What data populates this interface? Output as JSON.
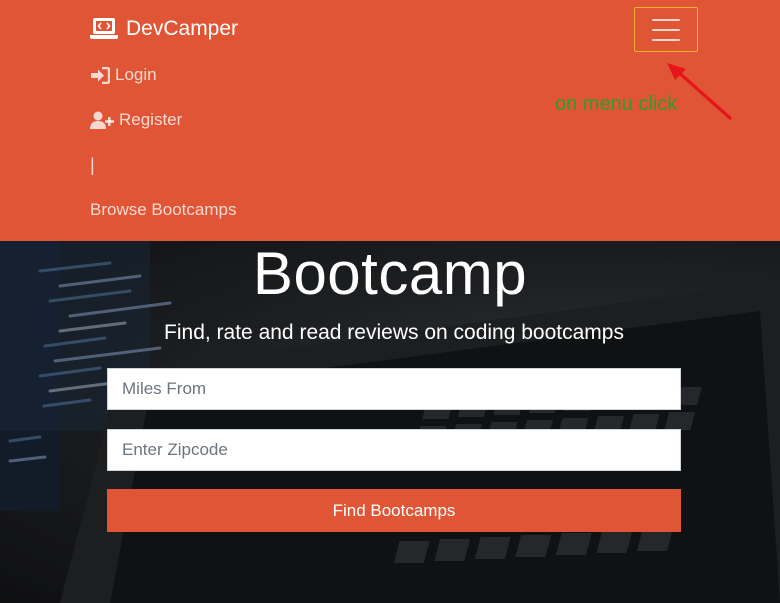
{
  "navbar": {
    "brand": "DevCamper",
    "brand_icon": "laptop-code-icon",
    "toggler_icon": "hamburger-menu-icon",
    "items": [
      {
        "label": "Login",
        "icon": "sign-in-icon"
      },
      {
        "label": "Register",
        "icon": "user-plus-icon"
      },
      {
        "label": "|"
      },
      {
        "label": "Browse Bootcamps"
      }
    ]
  },
  "annotation": {
    "text": "on menu click",
    "color": "#2e9e27",
    "arrow_color": "#e8141b"
  },
  "hero": {
    "title": "Bootcamp",
    "subtitle": "Find, rate and read reviews on coding bootcamps",
    "miles_placeholder": "Miles From",
    "zip_placeholder": "Enter Zipcode",
    "button_label": "Find Bootcamps"
  },
  "colors": {
    "primary": "#e05535",
    "toggler_border": "#f7b02f"
  }
}
